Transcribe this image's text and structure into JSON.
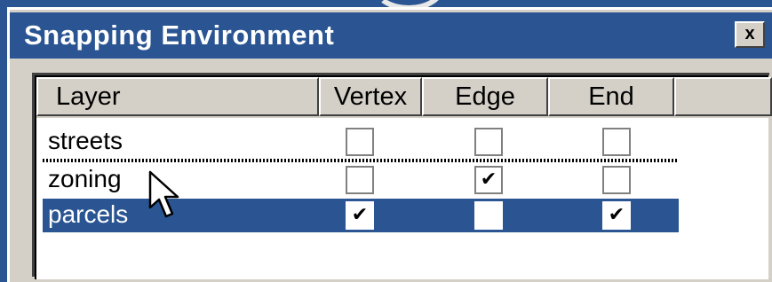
{
  "window": {
    "title": "Snapping Environment",
    "close_label": "x"
  },
  "columns": {
    "layer": "Layer",
    "vertex": "Vertex",
    "edge": "Edge",
    "end": "End"
  },
  "rows": [
    {
      "name": "streets",
      "vertex": false,
      "edge": false,
      "end": false,
      "selected": false
    },
    {
      "name": "zoning",
      "vertex": false,
      "edge": true,
      "end": false,
      "selected": false
    },
    {
      "name": "parcels",
      "vertex": true,
      "edge": false,
      "end": true,
      "selected": true
    }
  ],
  "check_glyph": "✔",
  "colors": {
    "titlebar": "#2a5592",
    "dialog_face": "#d4d0c8",
    "selection": "#2a5592"
  },
  "icons": {
    "close": "close-icon",
    "cursor": "arrow-cursor-icon"
  }
}
